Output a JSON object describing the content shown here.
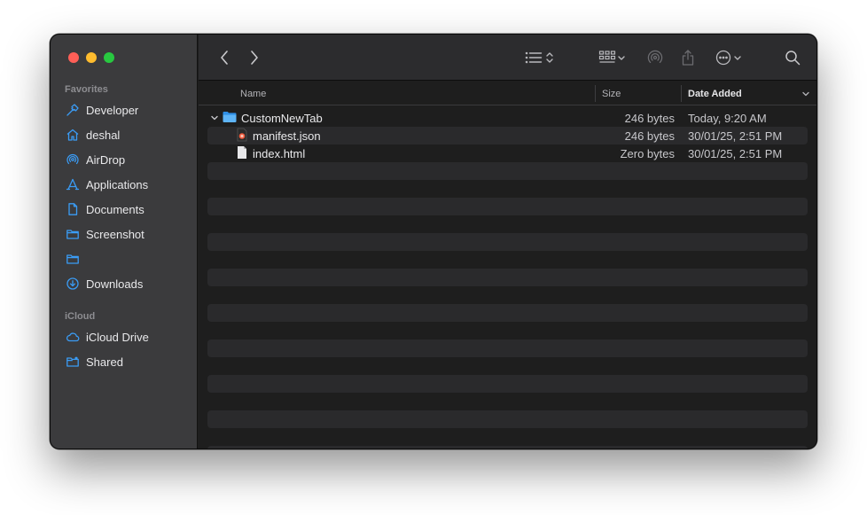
{
  "sidebar": {
    "sections": {
      "favorites": "Favorites",
      "icloud": "iCloud"
    },
    "favorites": [
      {
        "label": "Developer",
        "icon": "hammer-icon"
      },
      {
        "label": "deshal",
        "icon": "home-icon"
      },
      {
        "label": "AirDrop",
        "icon": "airdrop-icon"
      },
      {
        "label": "Applications",
        "icon": "applications-icon"
      },
      {
        "label": "Documents",
        "icon": "document-icon"
      },
      {
        "label": "Screenshot",
        "icon": "folder-icon"
      },
      {
        "label": "",
        "icon": "folder-icon"
      },
      {
        "label": "Downloads",
        "icon": "download-icon"
      }
    ],
    "icloud": [
      {
        "label": "iCloud Drive",
        "icon": "cloud-icon"
      },
      {
        "label": "Shared",
        "icon": "shared-folder-icon"
      }
    ]
  },
  "columns": {
    "name": "Name",
    "size": "Size",
    "date_added": "Date Added"
  },
  "files": [
    {
      "name": "CustomNewTab",
      "size": "246 bytes",
      "date": "Today, 9:20 AM",
      "kind": "folder",
      "expanded": true
    },
    {
      "name": "manifest.json",
      "size": "246 bytes",
      "date": "30/01/25, 2:51 PM",
      "kind": "json"
    },
    {
      "name": "index.html",
      "size": "Zero bytes",
      "date": "30/01/25, 2:51 PM",
      "kind": "html"
    }
  ],
  "colors": {
    "accent": "#3b9cf5",
    "sidebar_bg": "#3b3b3d",
    "content_bg": "#1e1e1e",
    "stripe": "#2a2a2c"
  }
}
